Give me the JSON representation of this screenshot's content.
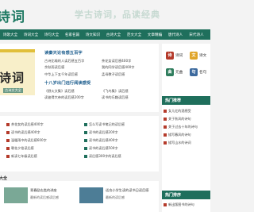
{
  "header": {
    "logo_text": "诗词",
    "slogan": "学古诗词，品读经典"
  },
  "nav": {
    "items": [
      "诗歌大全",
      "诗词大全",
      "诗句大全",
      "名家名篇",
      "诗文知识",
      "古诗大全",
      "范文大全",
      "文章精编",
      "唐代诗人",
      "宋代诗人"
    ]
  },
  "banner": {
    "title": "诗词",
    "sub": "古诗文大全"
  },
  "news": {
    "headline": "读秦天论有感五百字",
    "rows_top": [
      [
        "古诗比喻的人读后感五百字",
        "茶花女读后感400字"
      ],
      [
        "余秋雨读后感",
        "我的同学读后感400字"
      ],
      [
        "中华上下五千年读后感",
        "孟母教子读后感"
      ]
    ],
    "headline2": "十八岁出门远行阅读感受",
    "rows_bottom": [
      [
        "《野火文集》读后感",
        "《飞鸟集》读后感"
      ],
      [
        "读彼得大帝的读后感200字",
        "读书的乐趣读后感"
      ]
    ]
  },
  "right_panel": {
    "shortcuts": [
      {
        "label": "诗词",
        "color": "#b43a2a"
      },
      {
        "label": "诗文",
        "color": "#e0a52a"
      },
      {
        "label": "元曲",
        "color": "#2f7d5d"
      },
      {
        "label": "名句",
        "color": "#3d6a9e"
      }
    ],
    "section1_title": "热门推荐",
    "section1_items": [
      "女儿红的酒感受",
      "关于秋风的诗句",
      "关于过去十年的诗句",
      "描写春风的诗句",
      "描写山水的诗词"
    ],
    "section2_title": "热门排序",
    "section2_items": [
      "新出版图书的诗句"
    ]
  },
  "lists": {
    "col1": [
      "茶花女的读后感400字",
      "读书的读后感400字",
      "温暖雨中的读后感600字",
      "朝花夕拾读后感",
      "新读七年级读后感"
    ],
    "col2": [
      "怎么写读书笔记的读后感",
      "读书的读后感200字",
      "读书的读后感400字",
      "读书的读后感500字",
      "读后感300字的读后感"
    ]
  },
  "bottom": {
    "title": "大全",
    "items": [
      {
        "title": "青春励志类的讲座",
        "sub": "最新的读后感读后感"
      },
      {
        "title": "适合小学生读的读书日读后感",
        "sub": "最新的读后感"
      }
    ]
  }
}
